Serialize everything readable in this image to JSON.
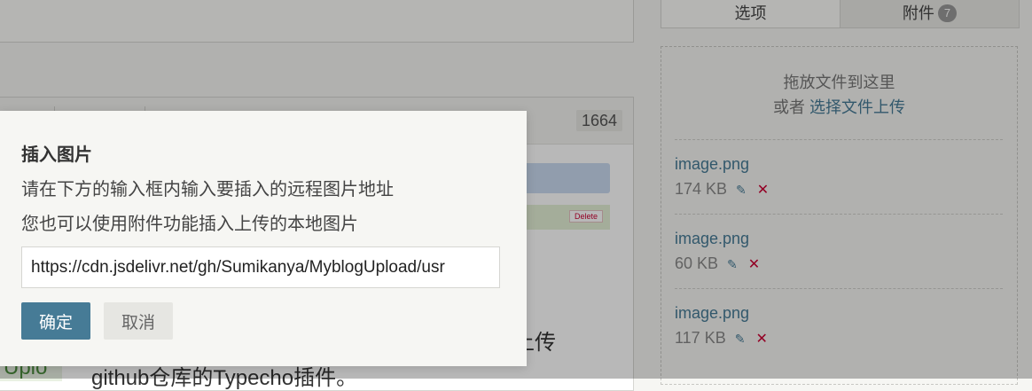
{
  "editor": {
    "word_count": "1664",
    "row_delete_label": "Delete",
    "text_visible": "github仓库的Typecho插件。",
    "text_right": "上传",
    "left_strip_text": "Uplo"
  },
  "attachments": {
    "tabs": [
      {
        "label": "选项"
      },
      {
        "label": "附件",
        "count": "7"
      }
    ],
    "dropzone_line1": "拖放文件到这里",
    "dropzone_or": "或者 ",
    "dropzone_link": "选择文件上传",
    "files": [
      {
        "name": "image.png",
        "size": "174 KB"
      },
      {
        "name": "image.png",
        "size": "60 KB"
      },
      {
        "name": "image.png",
        "size": "117 KB"
      }
    ]
  },
  "dialog": {
    "title": "插入图片",
    "line1": "请在下方的输入框内输入要插入的远程图片地址",
    "line2": "您也可以使用附件功能插入上传的本地图片",
    "url_value": "https://cdn.jsdelivr.net/gh/Sumikanya/MyblogUpload/usr",
    "confirm_label": "确定",
    "cancel_label": "取消"
  },
  "colors": {
    "accent": "#467b96",
    "danger": "#cc0033",
    "badge": "#999999"
  },
  "icons": {
    "edit": "pencil-icon",
    "delete": "close-icon"
  }
}
